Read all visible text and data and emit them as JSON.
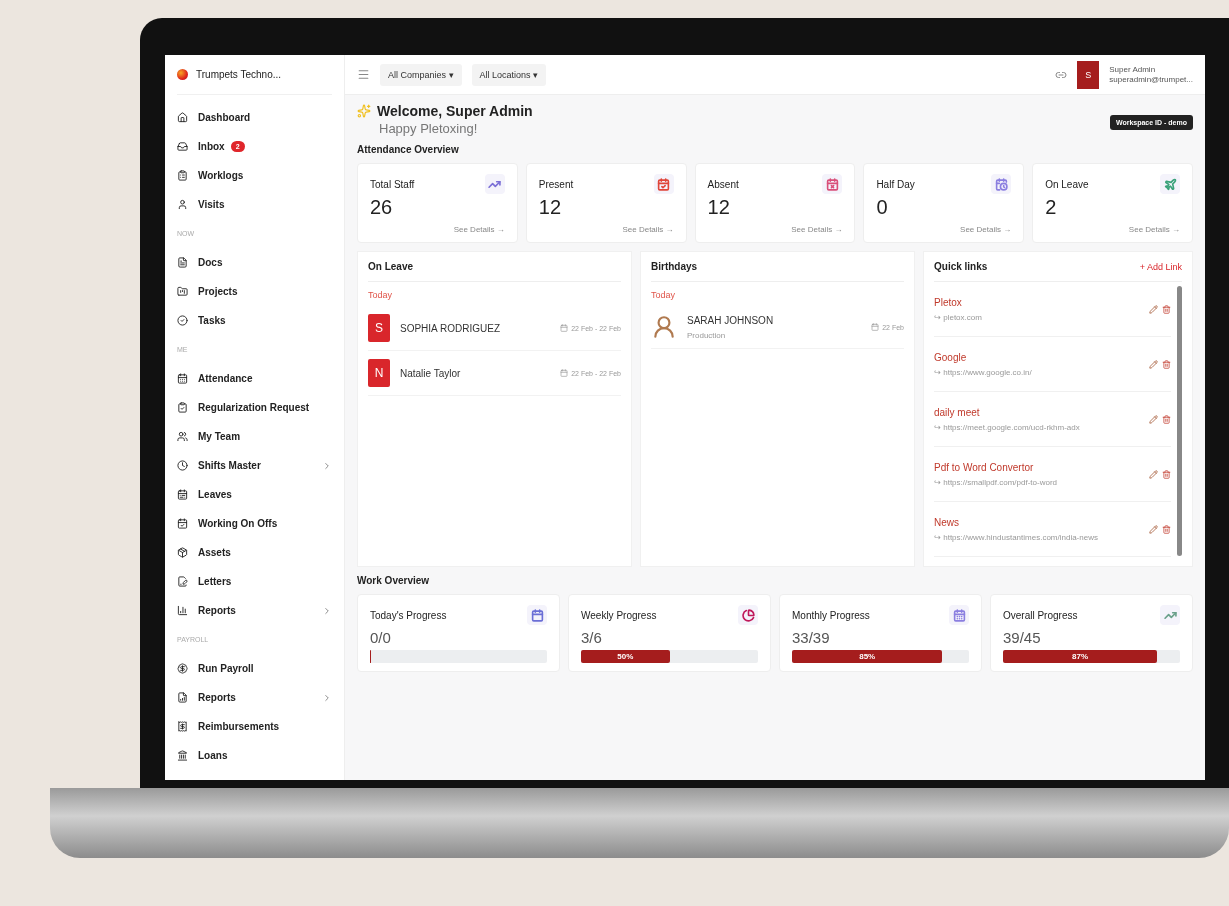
{
  "sidebar": {
    "brand": "Trumpets Techno...",
    "items": [
      {
        "kind": "item",
        "label": "Dashboard",
        "has_submenu": false
      },
      {
        "kind": "item",
        "label": "Inbox",
        "badge": "2",
        "has_submenu": false
      },
      {
        "kind": "item",
        "label": "Worklogs",
        "has_submenu": false
      },
      {
        "kind": "item",
        "label": "Visits",
        "has_submenu": false
      },
      {
        "kind": "header",
        "label": "NOW"
      },
      {
        "kind": "item",
        "label": "Docs",
        "has_submenu": false
      },
      {
        "kind": "item",
        "label": "Projects",
        "has_submenu": false
      },
      {
        "kind": "item",
        "label": "Tasks",
        "has_submenu": false
      },
      {
        "kind": "header",
        "label": "ME"
      },
      {
        "kind": "item",
        "label": "Attendance",
        "has_submenu": false
      },
      {
        "kind": "item",
        "label": "Regularization Request",
        "has_submenu": false
      },
      {
        "kind": "item",
        "label": "My Team",
        "has_submenu": false
      },
      {
        "kind": "item",
        "label": "Shifts Master",
        "has_submenu": true
      },
      {
        "kind": "item",
        "label": "Leaves",
        "has_submenu": false
      },
      {
        "kind": "item",
        "label": "Working On Offs",
        "has_submenu": false
      },
      {
        "kind": "item",
        "label": "Assets",
        "has_submenu": false
      },
      {
        "kind": "item",
        "label": "Letters",
        "has_submenu": false
      },
      {
        "kind": "item",
        "label": "Reports",
        "has_submenu": true
      },
      {
        "kind": "header",
        "label": "PAYROLL"
      },
      {
        "kind": "item",
        "label": "Run Payroll",
        "has_submenu": false
      },
      {
        "kind": "item",
        "label": "Reports",
        "has_submenu": true
      },
      {
        "kind": "item",
        "label": "Reimbursements",
        "has_submenu": false
      },
      {
        "kind": "item",
        "label": "Loans",
        "has_submenu": false
      }
    ]
  },
  "topbar": {
    "filters": [
      "All Companies ▾",
      "All Locations ▾"
    ],
    "user": {
      "initial": "S",
      "name": "Super Admin",
      "email": "superadmin@trumpet..."
    }
  },
  "welcome": {
    "title": "Welcome, Super Admin",
    "subtitle": "Happy Pletoxing!",
    "workspace": "Workspace ID - demo"
  },
  "attendance": {
    "heading": "Attendance Overview",
    "cards": [
      {
        "title": "Total Staff",
        "value": "26",
        "link": "See Details →",
        "color": "#7b6fd6"
      },
      {
        "title": "Present",
        "value": "12",
        "link": "See Details →",
        "color": "#e0463a"
      },
      {
        "title": "Absent",
        "value": "12",
        "link": "See Details →",
        "color": "#d9507a"
      },
      {
        "title": "Half Day",
        "value": "0",
        "link": "See Details →",
        "color": "#8b7fe0"
      },
      {
        "title": "On Leave",
        "value": "2",
        "link": "See Details →",
        "color": "#3aa27a"
      }
    ]
  },
  "on_leave": {
    "title": "On Leave",
    "group": "Today",
    "people": [
      {
        "initial": "S",
        "name": "SOPHIA RODRIGUEZ",
        "dates": "22 Feb - 22 Feb"
      },
      {
        "initial": "N",
        "name": "Natalie Taylor",
        "dates": "22 Feb - 22 Feb"
      }
    ]
  },
  "birthdays": {
    "title": "Birthdays",
    "group": "Today",
    "people": [
      {
        "name": "SARAH JOHNSON",
        "department": "Production",
        "date": "22 Feb"
      }
    ]
  },
  "quick_links": {
    "title": "Quick links",
    "add": "+ Add Link",
    "links": [
      {
        "name": "Pletox",
        "url": "↪ pletox.com"
      },
      {
        "name": "Google",
        "url": "↪ https://www.google.co.in/"
      },
      {
        "name": "daily meet",
        "url": "↪ https://meet.google.com/ucd-rkhm-adx"
      },
      {
        "name": "Pdf to Word Convertor",
        "url": "↪ https://smallpdf.com/pdf-to-word"
      },
      {
        "name": "News",
        "url": "↪ https://www.hindustantimes.com/india-news"
      }
    ]
  },
  "work": {
    "heading": "Work Overview",
    "cards": [
      {
        "title": "Today's Progress",
        "value": "0/0",
        "level": 0,
        "color": "#6b6fd6"
      },
      {
        "title": "Weekly Progress",
        "value": "3/6",
        "level": 0.5,
        "label": "50%",
        "color": "#c0185a"
      },
      {
        "title": "Monthly Progress",
        "value": "33/39",
        "level": 0.85,
        "label": "85%",
        "color": "#8b7fe0"
      },
      {
        "title": "Overall Progress",
        "value": "39/45",
        "level": 0.87,
        "label": "87%",
        "color": "#6aa08a"
      }
    ]
  }
}
